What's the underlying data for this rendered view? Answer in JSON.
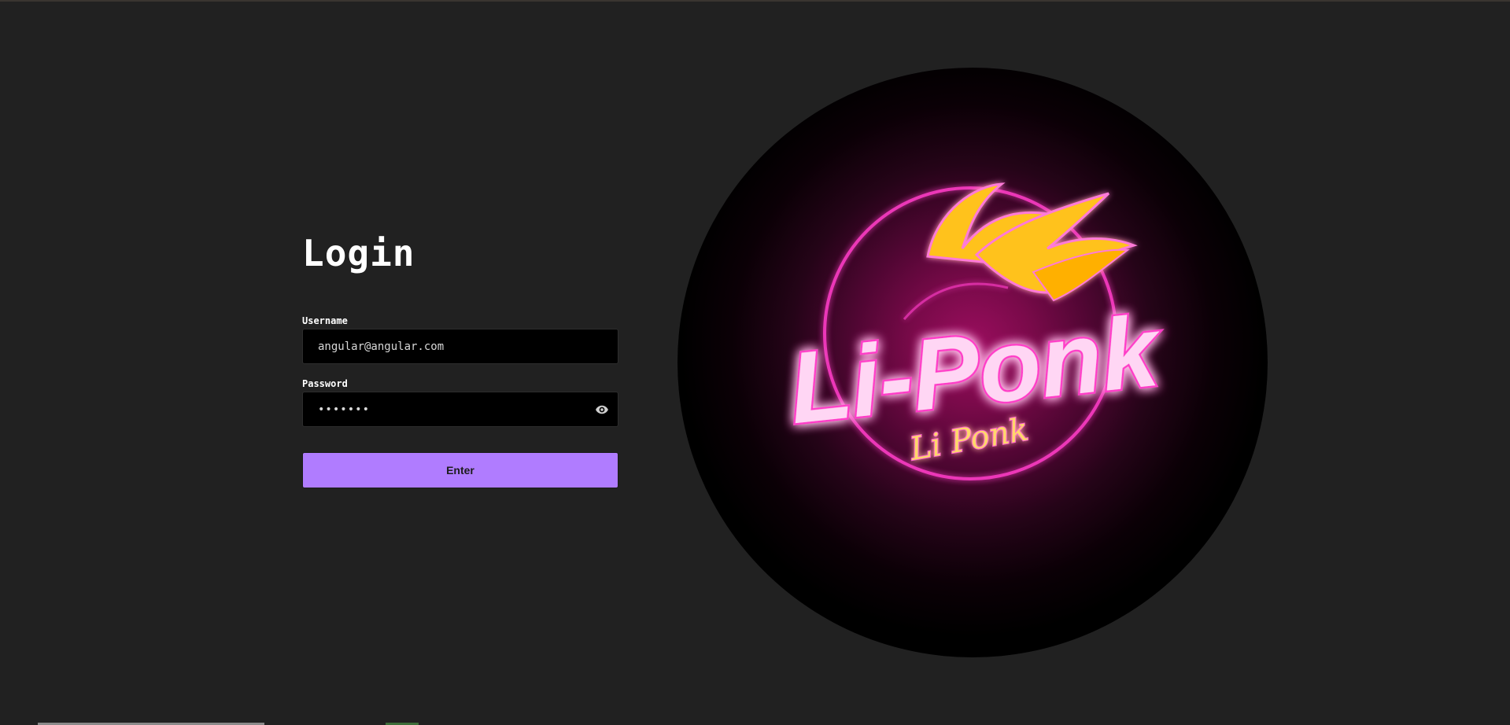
{
  "login": {
    "title": "Login",
    "username_label": "Username",
    "username_value": "angular@angular.com",
    "password_label": "Password",
    "password_value": "1234567",
    "enter_label": "Enter"
  },
  "logo": {
    "main_text": "Li-Ponk",
    "sub_text": "Li Ponk"
  },
  "colors": {
    "background": "#212121",
    "accent": "#b07cff",
    "neon_pink": "#ff4fd0",
    "flame": "#ffc21a"
  },
  "icons": {
    "password_toggle": "eye-icon"
  }
}
